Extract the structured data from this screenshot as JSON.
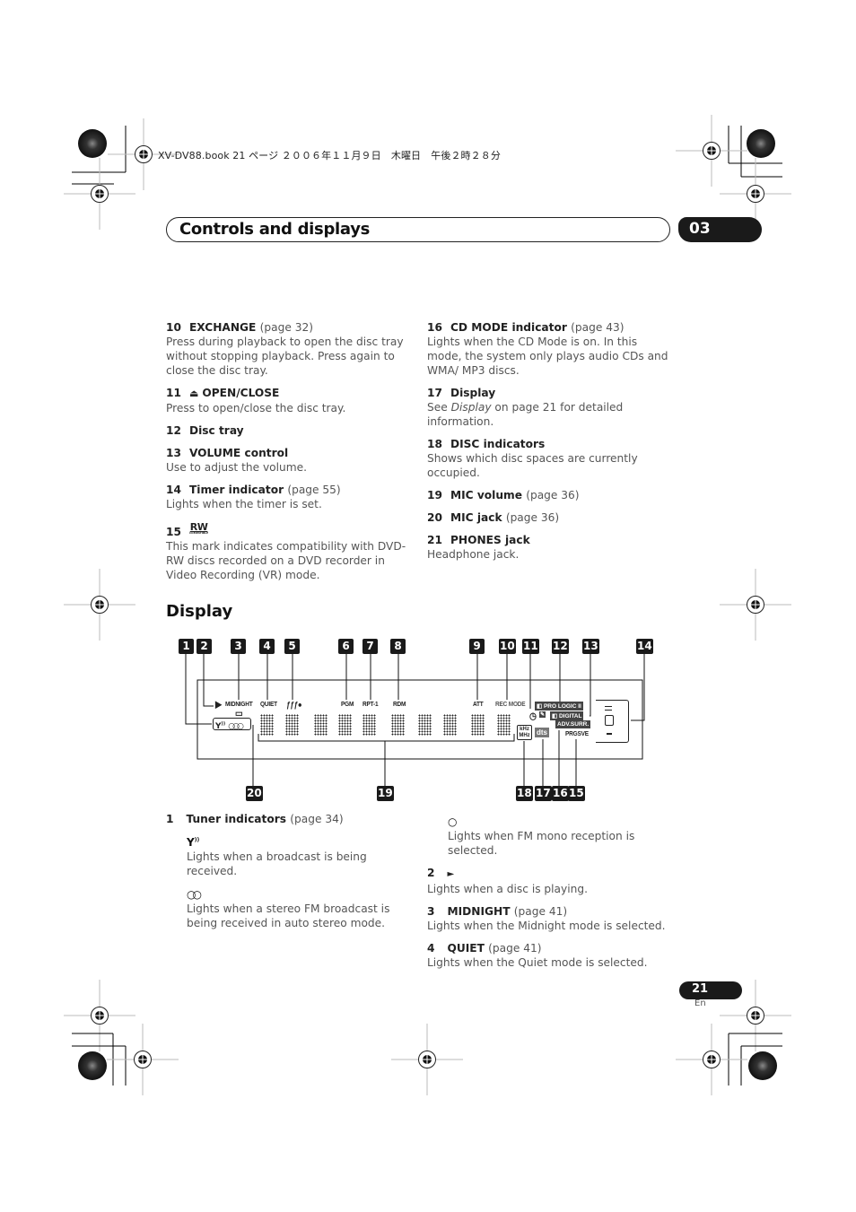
{
  "print_header": "XV-DV88.book  21 ページ  ２００６年１１月９日　木曜日　午後２時２８分",
  "section": {
    "title": "Controls and displays",
    "chapter": "03"
  },
  "left_items": [
    {
      "num": "10",
      "title": "EXCHANGE",
      "page_ref": "(page 32)",
      "desc": "Press during playback to open the disc tray without stopping playback. Press again to close the disc tray."
    },
    {
      "num": "11",
      "icon": "⏏",
      "title": "OPEN/CLOSE",
      "page_ref": "",
      "desc": "Press to open/close the disc tray."
    },
    {
      "num": "12",
      "title": "Disc tray",
      "page_ref": "",
      "desc": ""
    },
    {
      "num": "13",
      "title": "VOLUME control",
      "page_ref": "",
      "desc": "Use to adjust the volume."
    },
    {
      "num": "14",
      "title": "Timer indicator",
      "page_ref": "(page 55)",
      "desc": "Lights when the timer is set."
    },
    {
      "num": "15",
      "logo": "RW",
      "logo_sub": "COMPATIBLE",
      "title": "",
      "page_ref": "",
      "desc": "This mark indicates compatibility with DVD-RW discs recorded on a DVD recorder in Video Recording (VR) mode."
    }
  ],
  "right_items": [
    {
      "num": "16",
      "title": "CD MODE indicator",
      "page_ref": "(page 43)",
      "desc": "Lights when the CD Mode is on. In this mode, the system only plays audio CDs and WMA/ MP3 discs."
    },
    {
      "num": "17",
      "title": "Display",
      "page_ref": "",
      "desc_prefix": "See ",
      "desc_italic": "Display",
      "desc_suffix": " on page 21 for detailed information."
    },
    {
      "num": "18",
      "title": "DISC indicators",
      "page_ref": "",
      "desc": "Shows which disc spaces are currently occupied."
    },
    {
      "num": "19",
      "title": "MIC volume",
      "page_ref": "(page 36)",
      "desc": ""
    },
    {
      "num": "20",
      "title": "MIC jack",
      "page_ref": "(page 36)",
      "desc": ""
    },
    {
      "num": "21",
      "title": "PHONES jack",
      "page_ref": "",
      "desc": "Headphone jack."
    }
  ],
  "display_heading": "Display",
  "diagram": {
    "top_callouts": [
      "1",
      "2",
      "3",
      "4",
      "5",
      "6",
      "7",
      "8",
      "9",
      "10",
      "11",
      "12",
      "13",
      "14"
    ],
    "bottom_callouts": [
      "20",
      "19",
      "18",
      "17",
      "16",
      "15"
    ],
    "lcd_labels": {
      "play": "▶",
      "midnight": "MIDNIGHT",
      "quiet": "QUIET",
      "pgm": "PGM",
      "rpt": "RPT-1",
      "rdm": "RDM",
      "att": "ATT",
      "rec_mode": "REC MODE",
      "pro_logic": "PRO LOGIC  II",
      "digital": "DIGITAL",
      "adv_surr": "ADV.SURR.",
      "prgsve": "PRGSVE",
      "khz": "kHz",
      "mhz": "MHz",
      "dts": "dts",
      "tuner": "Y⁽⁾  ◯◯◯"
    }
  },
  "lower_left": {
    "item1": {
      "num": "1",
      "title": "Tuner indicators",
      "page_ref": "(page 34)"
    },
    "sub_items": [
      {
        "icon": "antenna-icon",
        "glyph": "Y",
        "desc": "Lights when a broadcast is being received."
      },
      {
        "icon": "stereo-icon",
        "glyph": "ꝏ",
        "desc": "Lights when a stereo FM broadcast is being received in auto stereo mode."
      }
    ]
  },
  "lower_right": {
    "mono": {
      "icon": "mono-icon",
      "glyph": "O",
      "desc": "Lights when FM mono reception is selected."
    },
    "items": [
      {
        "num": "2",
        "title": "",
        "glyph": "►",
        "page_ref": "",
        "desc": "Lights when a disc is playing."
      },
      {
        "num": "3",
        "title": "MIDNIGHT",
        "page_ref": "(page 41)",
        "desc": "Lights when the Midnight mode is selected."
      },
      {
        "num": "4",
        "title": "QUIET",
        "page_ref": "(page 41)",
        "desc": "Lights when the Quiet mode is selected."
      }
    ]
  },
  "footer": {
    "page_number": "21",
    "language": "En"
  }
}
